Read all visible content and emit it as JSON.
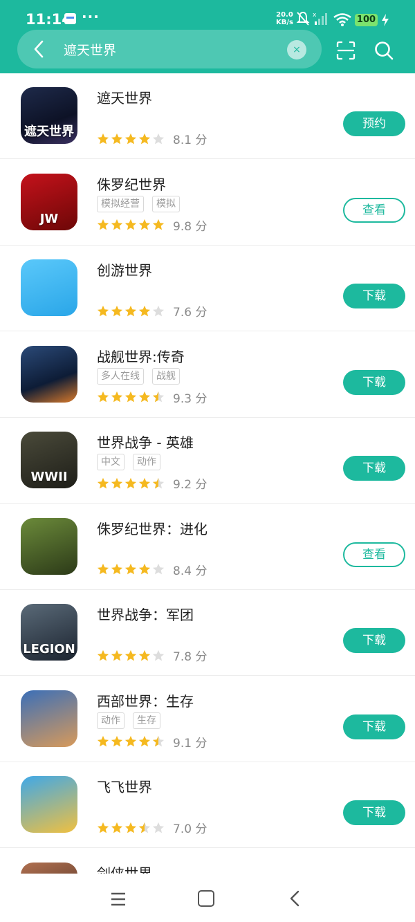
{
  "status": {
    "time": "11:14",
    "dots": "···",
    "speed_value": "20.0",
    "speed_unit": "KB/s",
    "battery": "100"
  },
  "search": {
    "value": "遮天世界",
    "clear_glyph": "×"
  },
  "colors": {
    "accent": "#1db99e",
    "star_filled": "#f5b920",
    "star_empty": "#dddddd"
  },
  "apps": [
    {
      "name": "遮天世界",
      "tags": [],
      "rating": 4,
      "score": "8.1 分",
      "button": "预约",
      "button_style": "filled",
      "icon": "zhetian-game-icon",
      "icon_text": "遮天世界"
    },
    {
      "name": "侏罗纪世界",
      "tags": [
        "模拟经营",
        "模拟"
      ],
      "rating": 5,
      "score": "9.8 分",
      "button": "查看",
      "button_style": "outline",
      "icon": "jurassic-world-icon",
      "icon_text": "JW"
    },
    {
      "name": "创游世界",
      "tags": [],
      "rating": 4,
      "score": "7.6 分",
      "button": "下载",
      "button_style": "filled",
      "icon": "chuangyou-icon",
      "icon_text": ""
    },
    {
      "name": "战舰世界:传奇",
      "tags": [
        "多人在线",
        "战舰"
      ],
      "rating": 4.5,
      "score": "9.3 分",
      "button": "下载",
      "button_style": "filled",
      "icon": "warships-icon",
      "icon_text": ""
    },
    {
      "name": "世界战争 - 英雄",
      "tags": [
        "中文",
        "动作"
      ],
      "rating": 4.5,
      "score": "9.2 分",
      "button": "下载",
      "button_style": "filled",
      "icon": "wwii-icon",
      "icon_text": "WWII"
    },
    {
      "name": "侏罗纪世界：进化",
      "tags": [],
      "rating": 4,
      "score": "8.4 分",
      "button": "查看",
      "button_style": "outline",
      "icon": "jurassic-evolution-icon",
      "icon_text": ""
    },
    {
      "name": "世界战争：军团",
      "tags": [],
      "rating": 4,
      "score": "7.8 分",
      "button": "下载",
      "button_style": "filled",
      "icon": "legion-icon",
      "icon_text": "LEGION"
    },
    {
      "name": "西部世界：生存",
      "tags": [
        "动作",
        "生存"
      ],
      "rating": 4.5,
      "score": "9.1 分",
      "button": "下载",
      "button_style": "filled",
      "icon": "westworld-icon",
      "icon_text": ""
    },
    {
      "name": "飞飞世界",
      "tags": [],
      "rating": 3.5,
      "score": "7.0 分",
      "button": "下载",
      "button_style": "filled",
      "icon": "feifei-icon",
      "icon_text": ""
    },
    {
      "name": "剑侠世界",
      "tags": [],
      "rating": 0,
      "score": "",
      "button": "",
      "button_style": "filled",
      "icon": "jianxia-icon",
      "icon_text": ""
    }
  ]
}
